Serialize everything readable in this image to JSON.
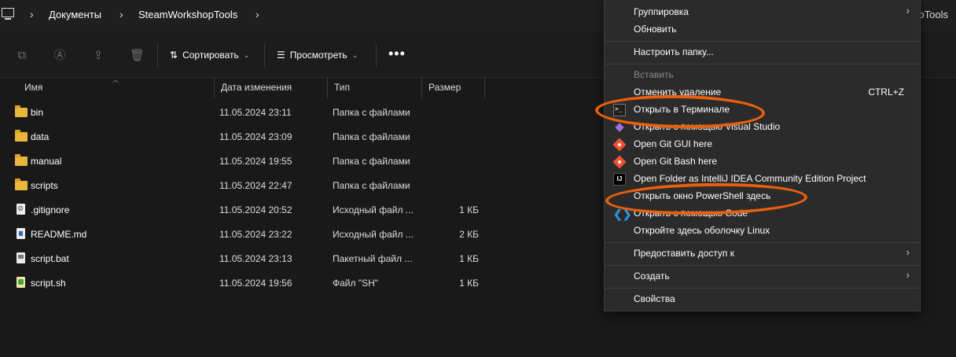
{
  "address": {
    "crumbs": [
      "Документы",
      "SteamWorkshopTools"
    ],
    "right_fragment": "oTools"
  },
  "toolbar": {
    "sort_label": "Сортировать",
    "view_label": "Просмотреть",
    "more_label": "•••"
  },
  "columns": [
    "Имя",
    "Дата изменения",
    "Тип",
    "Размер"
  ],
  "files": [
    {
      "name": "bin",
      "date": "11.05.2024 23:11",
      "type": "Папка с файлами",
      "size": "",
      "icon": "folder-icon"
    },
    {
      "name": "data",
      "date": "11.05.2024 23:09",
      "type": "Папка с файлами",
      "size": "",
      "icon": "folder-icon"
    },
    {
      "name": "manual",
      "date": "11.05.2024 19:55",
      "type": "Папка с файлами",
      "size": "",
      "icon": "folder-icon"
    },
    {
      "name": "scripts",
      "date": "11.05.2024 22:47",
      "type": "Папка с файлами",
      "size": "",
      "icon": "folder-icon"
    },
    {
      "name": ".gitignore",
      "date": "11.05.2024 20:52",
      "type": "Исходный файл ...",
      "size": "1 КБ",
      "icon": "gear-file-icon"
    },
    {
      "name": "README.md",
      "date": "11.05.2024 23:22",
      "type": "Исходный файл ...",
      "size": "2 КБ",
      "icon": "markdown-file-icon"
    },
    {
      "name": "script.bat",
      "date": "11.05.2024 23:13",
      "type": "Пакетный файл ...",
      "size": "1 КБ",
      "icon": "batch-file-icon"
    },
    {
      "name": "script.sh",
      "date": "11.05.2024 19:56",
      "type": "Файл \"SH\"",
      "size": "1 КБ",
      "icon": "shell-file-icon"
    }
  ],
  "menu": {
    "grouping": "Группировка",
    "refresh": "Обновить",
    "customize": "Настроить папку...",
    "paste": "Вставить",
    "undo": "Отменить удаление",
    "undo_shortcut": "CTRL+Z",
    "terminal": "Открыть в Терминале",
    "visual_studio": "Открыть с помощью Visual Studio",
    "git_gui": "Open Git GUI here",
    "git_bash": "Open Git Bash here",
    "intellij": "Open Folder as IntelliJ IDEA Community Edition Project",
    "powershell": "Открыть окно PowerShell здесь",
    "vscode": "Открыть с помощью Code",
    "linux_shell": "Откройте здесь оболочку Linux",
    "share": "Предоставить доступ к",
    "new": "Создать",
    "properties": "Свойства"
  },
  "colors": {
    "highlight_ring": "#ea5f0d",
    "folder": "#e8b63a",
    "menu_bg": "#2b2b2b",
    "window_bg": "#191919"
  }
}
